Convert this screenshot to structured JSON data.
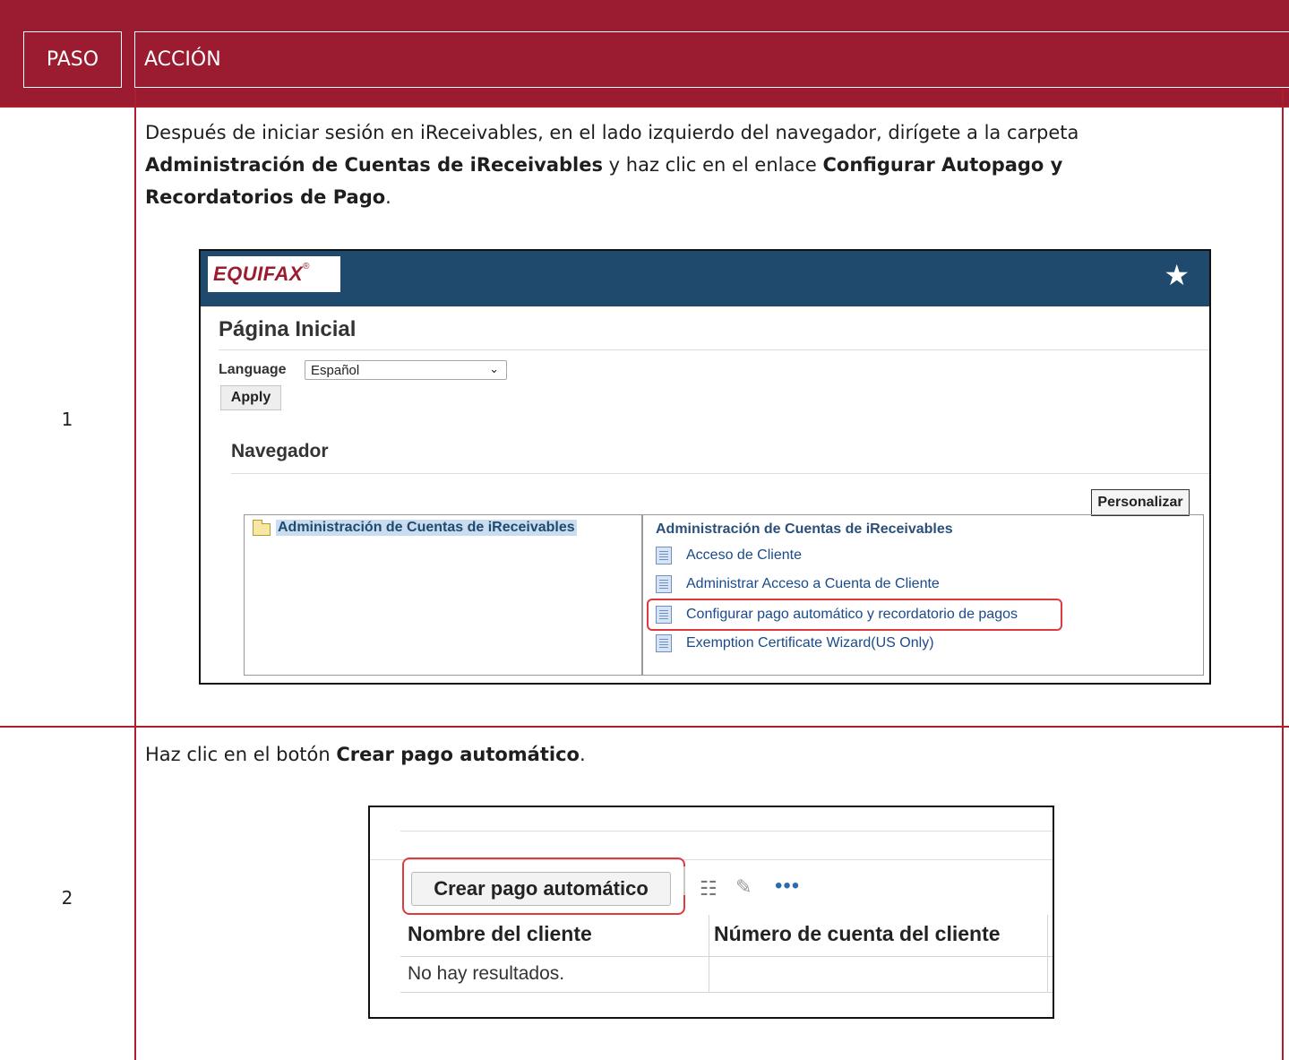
{
  "table": {
    "header": {
      "paso": "PASO",
      "accion": "ACCIÓN"
    },
    "steps": [
      {
        "number": "1",
        "text_1": "Después de iniciar sesión en iReceivables, en el lado izquierdo del navegador, dirígete a la carpeta ",
        "bold_1": "Administración de Cuentas de iReceivables",
        "text_2": " y haz clic en el enlace ",
        "bold_2": "Configurar Autopago y Recordatorios de Pago",
        "text_3": "."
      },
      {
        "number": "2",
        "text_1": "Haz clic en el botón ",
        "bold_1": "Crear pago automático",
        "text_2": "."
      }
    ]
  },
  "screenshot1": {
    "logo": "EQUIFAX",
    "logo_mark": "®",
    "star_icon": "star-icon",
    "page_title": "Página Inicial",
    "language_label": "Language",
    "language_value": "Español",
    "apply_label": "Apply",
    "navigator_title": "Navegador",
    "personalize_label": "Personalizar",
    "folder": "Administración de Cuentas de iReceivables",
    "links_heading": "Administración de Cuentas de iReceivables",
    "links": [
      "Acceso de Cliente",
      "Administrar Acceso a Cuenta de Cliente",
      "Configurar pago automático y recordatorio de pagos",
      "Exemption Certificate Wizard(US Only)"
    ],
    "highlight_color": "#e03a3e",
    "bar_color": "#1f4a6e"
  },
  "screenshot2": {
    "create_button": "Crear pago automático",
    "columns": [
      "Nombre del cliente",
      "Número de cuenta del cliente"
    ],
    "no_results": "No hay resultados.",
    "icons": [
      "filter-icon",
      "pencil-icon",
      "more-icon"
    ]
  },
  "colors": {
    "header_band": "#9b1b30",
    "grid_line": "#b01e2e"
  }
}
